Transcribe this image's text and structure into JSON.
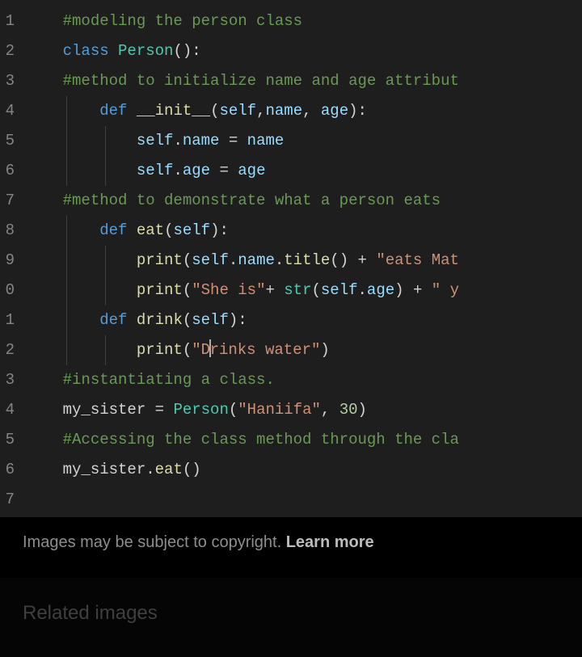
{
  "editor": {
    "gutter": [
      "1",
      "2",
      "3",
      "4",
      "5",
      "6",
      "7",
      "8",
      "9",
      "0",
      "1",
      "2",
      "3",
      "4",
      "5",
      "6",
      "7"
    ],
    "lines": [
      {
        "indent": 1,
        "tokens": [
          [
            "c-comment",
            "#modeling the person class"
          ]
        ]
      },
      {
        "indent": 1,
        "tokens": [
          [
            "c-keyword",
            "class"
          ],
          [
            "c-plain",
            " "
          ],
          [
            "c-class",
            "Person"
          ],
          [
            "c-paren",
            "()"
          ],
          [
            "c-plain",
            ":"
          ]
        ]
      },
      {
        "indent": 1,
        "tokens": [
          [
            "c-comment",
            "#method to initialize name and age attribut"
          ]
        ]
      },
      {
        "indent": 2,
        "guides": [
          1
        ],
        "tokens": [
          [
            "c-keyword",
            "def"
          ],
          [
            "c-plain",
            " "
          ],
          [
            "c-decl",
            "__init__"
          ],
          [
            "c-paren",
            "("
          ],
          [
            "c-self",
            "self"
          ],
          [
            "c-plain",
            ","
          ],
          [
            "c-param",
            "name"
          ],
          [
            "c-plain",
            ", "
          ],
          [
            "c-param",
            "age"
          ],
          [
            "c-paren",
            ")"
          ],
          [
            "c-plain",
            ":"
          ]
        ]
      },
      {
        "indent": 3,
        "guides": [
          1,
          2
        ],
        "tokens": [
          [
            "c-self",
            "self"
          ],
          [
            "c-plain",
            "."
          ],
          [
            "c-prop",
            "name"
          ],
          [
            "c-plain",
            " "
          ],
          [
            "c-op",
            "="
          ],
          [
            "c-plain",
            " "
          ],
          [
            "c-param",
            "name"
          ]
        ]
      },
      {
        "indent": 3,
        "guides": [
          1,
          2
        ],
        "tokens": [
          [
            "c-self",
            "self"
          ],
          [
            "c-plain",
            "."
          ],
          [
            "c-prop",
            "age"
          ],
          [
            "c-plain",
            " "
          ],
          [
            "c-op",
            "="
          ],
          [
            "c-plain",
            " "
          ],
          [
            "c-param",
            "age"
          ]
        ]
      },
      {
        "indent": 1,
        "tokens": [
          [
            "c-comment",
            "#method to demonstrate what a person eats"
          ]
        ]
      },
      {
        "indent": 2,
        "guides": [
          1
        ],
        "tokens": [
          [
            "c-keyword",
            "def"
          ],
          [
            "c-plain",
            " "
          ],
          [
            "c-decl",
            "eat"
          ],
          [
            "c-paren",
            "("
          ],
          [
            "c-self",
            "self"
          ],
          [
            "c-paren",
            ")"
          ],
          [
            "c-plain",
            ":"
          ]
        ]
      },
      {
        "indent": 3,
        "guides": [
          1,
          2
        ],
        "tokens": [
          [
            "c-func",
            "print"
          ],
          [
            "c-paren",
            "("
          ],
          [
            "c-self",
            "self"
          ],
          [
            "c-plain",
            "."
          ],
          [
            "c-prop",
            "name"
          ],
          [
            "c-plain",
            "."
          ],
          [
            "c-func",
            "title"
          ],
          [
            "c-paren",
            "()"
          ],
          [
            "c-plain",
            " "
          ],
          [
            "c-op",
            "+"
          ],
          [
            "c-plain",
            " "
          ],
          [
            "c-string",
            "\"eats Mat"
          ]
        ]
      },
      {
        "indent": 3,
        "guides": [
          1,
          2
        ],
        "tokens": [
          [
            "c-func",
            "print"
          ],
          [
            "c-paren",
            "("
          ],
          [
            "c-string",
            "\"She is\""
          ],
          [
            "c-op",
            "+"
          ],
          [
            "c-plain",
            " "
          ],
          [
            "c-builtin",
            "str"
          ],
          [
            "c-paren",
            "("
          ],
          [
            "c-self",
            "self"
          ],
          [
            "c-plain",
            "."
          ],
          [
            "c-prop",
            "age"
          ],
          [
            "c-paren",
            ")"
          ],
          [
            "c-plain",
            " "
          ],
          [
            "c-op",
            "+"
          ],
          [
            "c-plain",
            " "
          ],
          [
            "c-string",
            "\" y"
          ]
        ]
      },
      {
        "indent": 2,
        "guides": [
          1
        ],
        "tokens": [
          [
            "c-keyword",
            "def"
          ],
          [
            "c-plain",
            " "
          ],
          [
            "c-decl",
            "drink"
          ],
          [
            "c-paren",
            "("
          ],
          [
            "c-self",
            "self"
          ],
          [
            "c-paren",
            ")"
          ],
          [
            "c-plain",
            ":"
          ]
        ]
      },
      {
        "indent": 3,
        "guides": [
          1,
          2
        ],
        "cursor_at": 7,
        "tokens": [
          [
            "c-func",
            "print"
          ],
          [
            "c-paren",
            "("
          ],
          [
            "c-string",
            "\"D"
          ],
          [
            "cursor",
            ""
          ],
          [
            "c-string",
            "rinks water\""
          ],
          [
            "c-paren",
            ")"
          ]
        ]
      },
      {
        "indent": 1,
        "tokens": [
          [
            "c-comment",
            "#instantiating a class."
          ]
        ]
      },
      {
        "indent": 1,
        "tokens": [
          [
            "c-plain",
            "my_sister "
          ],
          [
            "c-op",
            "="
          ],
          [
            "c-plain",
            " "
          ],
          [
            "c-class",
            "Person"
          ],
          [
            "c-paren",
            "("
          ],
          [
            "c-string",
            "\"Haniifa\""
          ],
          [
            "c-plain",
            ", "
          ],
          [
            "c-num",
            "30"
          ],
          [
            "c-paren",
            ")"
          ]
        ]
      },
      {
        "indent": 1,
        "tokens": [
          [
            "c-comment",
            "#Accessing the class method through the cla"
          ]
        ]
      },
      {
        "indent": 1,
        "tokens": [
          [
            "c-plain",
            "my_sister."
          ],
          [
            "c-func",
            "eat"
          ],
          [
            "c-paren",
            "()"
          ]
        ]
      },
      {
        "indent": 0,
        "tokens": []
      }
    ]
  },
  "footer": {
    "copyright_text": "Images may be subject to copyright. ",
    "learn_more": "Learn more",
    "related_heading": "Related images"
  }
}
